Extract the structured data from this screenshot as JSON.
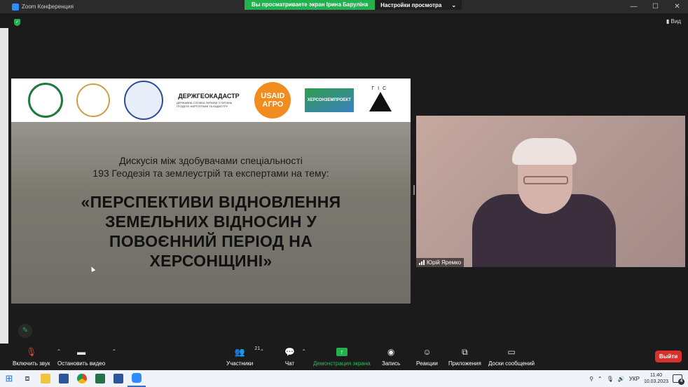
{
  "window": {
    "title": "Zoom Конференция",
    "share_banner": {
      "viewing": "Вы просматриваете экран Ірина Баруліна",
      "options": "Настройки просмотра"
    },
    "controls": {
      "minimize": "—",
      "maximize": "☐",
      "close": "✕"
    },
    "view_button": "Вид"
  },
  "slide": {
    "logos": {
      "geo_main": "ДЕРЖГЕОКАДАСТР",
      "geo_sub": "ДЕРЖАВНА СЛУЖБА УКРАЇНИ З ПИТАНЬ ГЕОДЕЗІЇ, КАРТОГРАФІЇ ТА КАДАСТРУ",
      "usaid_1": "USAID",
      "usaid_2": "АГРО",
      "kherson": "ХЕРСОНЗЕМПРОЕКТ",
      "gis": "ГІС"
    },
    "subtitle_1": "Дискусія між здобувачами спеціальності",
    "subtitle_2": "193 Геодезія та землеустрій та експертами на тему:",
    "headline": "«ПЕРСПЕКТИВИ ВІДНОВЛЕННЯ ЗЕМЕЛЬНИХ ВІДНОСИН У ПОВОЄННИЙ ПЕРІОД НА ХЕРСОНЩИНІ»"
  },
  "video": {
    "participant_name": "Юрій Яремко"
  },
  "toolbar": {
    "mute": "Включить звук",
    "video": "Остановить видео",
    "participants": "Участники",
    "participants_count": "21",
    "chat": "Чат",
    "share": "Демонстрация экрана",
    "record": "Запись",
    "reactions": "Реакции",
    "apps": "Приложения",
    "whiteboards": "Доски сообщений",
    "leave": "Выйти"
  },
  "taskbar": {
    "lang": "УКР",
    "time": "11:40",
    "date": "10.03.2023",
    "notifications": "4"
  },
  "colors": {
    "accent_green": "#23b04f",
    "leave_red": "#d8302a",
    "usaid_orange": "#f28c1f"
  }
}
